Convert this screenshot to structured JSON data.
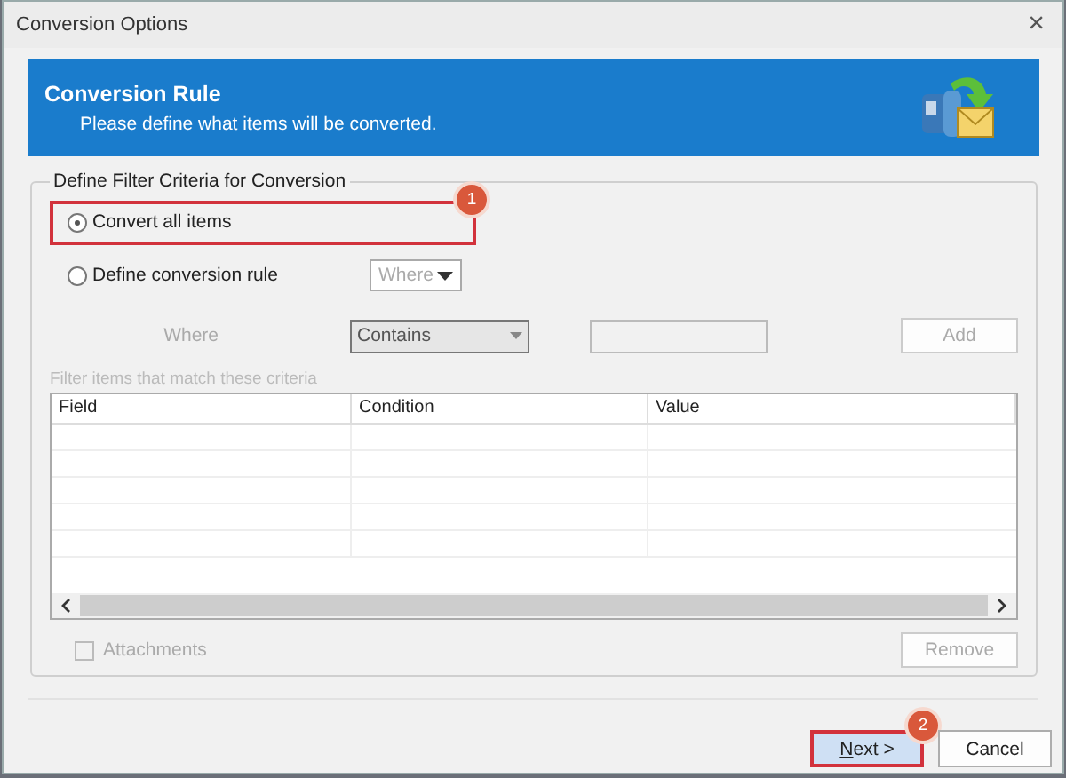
{
  "window": {
    "title": "Conversion Options",
    "close": "×"
  },
  "banner": {
    "title": "Conversion Rule",
    "subtitle": "Please define what items will be converted."
  },
  "group": {
    "legend": "Define Filter Criteria for Conversion",
    "options": [
      {
        "label": "Convert all items",
        "selected": true,
        "highlighted": true,
        "badge": "1"
      },
      {
        "label": "Define conversion rule",
        "selected": false,
        "highlighted": false
      }
    ],
    "where_dropdown": {
      "value": "Where",
      "disabled": true
    },
    "where_label": "Where",
    "condition_combo": {
      "value": "Contains",
      "disabled": true
    },
    "value_field": {
      "disabled": true
    },
    "add_button": {
      "label": "Add",
      "disabled": true
    },
    "hint": "Filter items that match these criteria",
    "table": {
      "columns": [
        "Field",
        "Condition",
        "Value"
      ]
    },
    "attachments": {
      "label": "Attachments",
      "checked": false,
      "disabled": true
    },
    "remove_button": {
      "label": "Remove",
      "disabled": true
    }
  },
  "buttons": [
    {
      "label": "Next >",
      "highlighted": true,
      "badge": "2"
    },
    {
      "label": "Cancel",
      "highlighted": false
    }
  ]
}
